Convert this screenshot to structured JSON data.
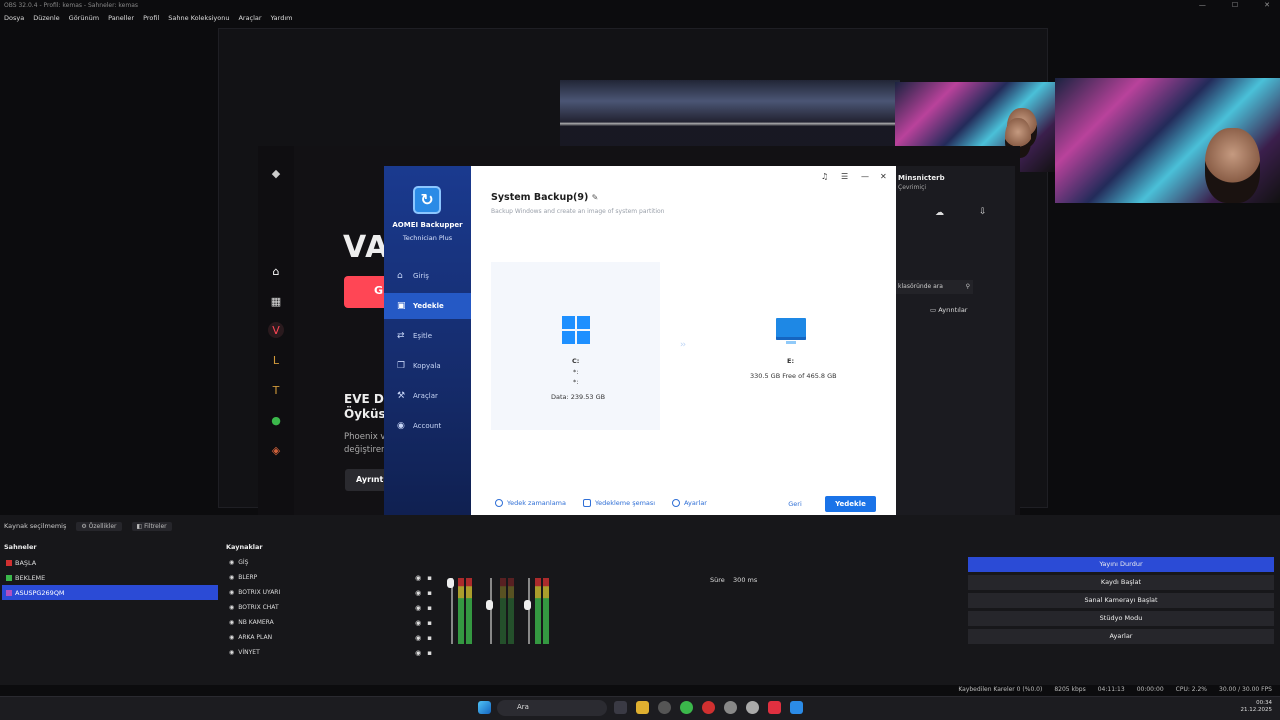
{
  "obs": {
    "title": "OBS 32.0.4 - Profil: kemas - Sahneler: kemas",
    "menu": [
      "Dosya",
      "Düzenle",
      "Görünüm",
      "Paneller",
      "Profil",
      "Sahne Koleksiyonu",
      "Araçlar",
      "Yardım"
    ],
    "source_bar": {
      "label": "Kaynak seçilmemiş",
      "props": "Özellikler",
      "filters": "Filtreler"
    },
    "scenes_header": "Sahneler",
    "sources_header": "Kaynaklar",
    "scenes": [
      {
        "name": "BAŞLA",
        "color": "#d03030"
      },
      {
        "name": "BEKLEME",
        "color": "#3bb84b"
      },
      {
        "name": "ASUSPG269QM",
        "color": "#b050c0"
      }
    ],
    "sources": [
      "GİŞ",
      "BLERP",
      "BOTRIX UYARI",
      "BOTRIX CHAT",
      "NB KAMERA",
      "ARKA PLAN",
      "VİNYET"
    ],
    "transition": {
      "label": "Süre",
      "value": "300 ms"
    },
    "controls": [
      "Yayını Durdur",
      "Kaydı Başlat",
      "Sanal Kamerayı Başlat",
      "Stüdyo Modu",
      "Ayarlar"
    ],
    "status": {
      "dropped": "Kaybedilen Kareler 0 (%0.0)",
      "kbps": "8205 kbps",
      "live": "04:11:13",
      "rec": "00:00:00",
      "cpu": "CPU: 2.2%",
      "fps": "30.00 / 30.00 FPS"
    }
  },
  "phoenix": {
    "brand": "VAL",
    "btn": "G",
    "headline": [
      "EVE DÖ",
      "Öyküsü"
    ],
    "sub": [
      "Phoenix ve",
      "değiştiren"
    ],
    "details_btn": "Ayrıntı"
  },
  "side_panel": {
    "name": "Minsnicterb",
    "sub": "Çevrimiçi",
    "search": "klasöründe ara",
    "details": "Ayrıntılar"
  },
  "aomei": {
    "product": "AOMEI Backupper",
    "edition": "Technician Plus",
    "nav": [
      {
        "label": "Giriş",
        "icon": "home-icon",
        "glyph": "⌂"
      },
      {
        "label": "Yedekle",
        "icon": "backup-icon",
        "glyph": "▣"
      },
      {
        "label": "Eşitle",
        "icon": "sync-icon",
        "glyph": "⇄"
      },
      {
        "label": "Kopyala",
        "icon": "copy-icon",
        "glyph": "❐"
      },
      {
        "label": "Araçlar",
        "icon": "tools-icon",
        "glyph": "⚒"
      },
      {
        "label": "Account",
        "icon": "account-icon",
        "glyph": "◉"
      }
    ],
    "active_nav": "Yedekle",
    "title": "System Backup(9)",
    "subtitle": "Backup Windows and create an image of system partition",
    "source": {
      "drive": "C:",
      "line2": "*:",
      "line3": "*:",
      "data": "Data: 239.53 GB"
    },
    "dest": {
      "drive": "E:",
      "free": "330.5 GB Free of 465.8 GB"
    },
    "footer": {
      "schedule": "Yedek zamanlama",
      "scheme": "Yedekleme şeması",
      "options": "Ayarlar",
      "back": "Geri",
      "primary": "Yedekle"
    }
  },
  "taskbar": {
    "search": "Ara",
    "time": "00:34",
    "date": "21.12.2025"
  }
}
